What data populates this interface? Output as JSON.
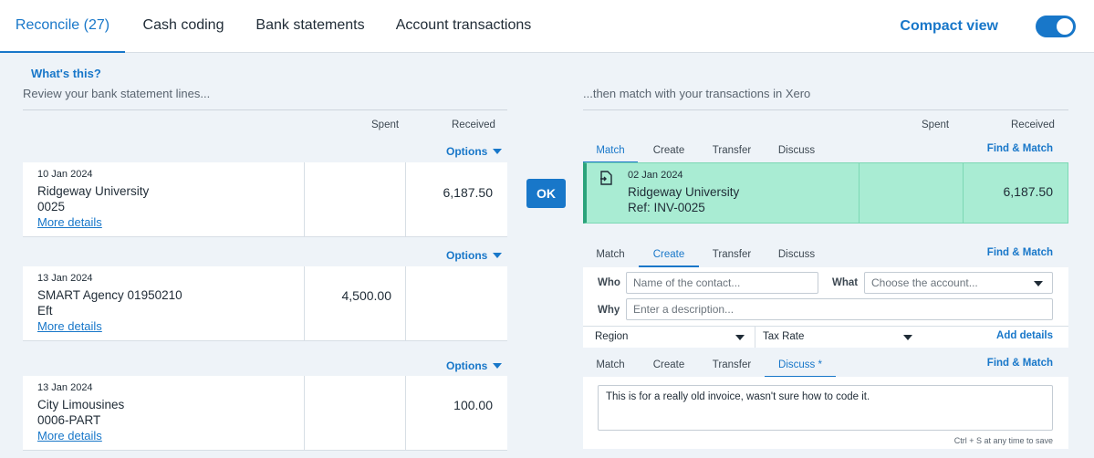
{
  "nav": {
    "tabs": [
      "Reconcile (27)",
      "Cash coding",
      "Bank statements",
      "Account transactions"
    ],
    "compact_view_label": "Compact view",
    "compact_view_on": true
  },
  "left": {
    "whats_this": "What's this?",
    "heading": "Review your bank statement lines...",
    "col_spent": "Spent",
    "col_received": "Received",
    "options_label": "Options",
    "lines": [
      {
        "date": "10 Jan 2024",
        "payee": "Ridgeway University",
        "ref": "0025",
        "more": "More details",
        "spent": "",
        "received": "6,187.50"
      },
      {
        "date": "13 Jan 2024",
        "payee": "SMART Agency 01950210",
        "ref": "Eft",
        "more": "More details",
        "spent": "4,500.00",
        "received": ""
      },
      {
        "date": "13 Jan 2024",
        "payee": "City Limousines",
        "ref": "0006-PART",
        "more": "More details",
        "spent": "",
        "received": "100.00"
      }
    ]
  },
  "ok_label": "OK",
  "right": {
    "heading": "...then match with your transactions in Xero",
    "col_spent": "Spent",
    "col_received": "Received",
    "tabs": [
      "Match",
      "Create",
      "Transfer",
      "Discuss"
    ],
    "discuss_modified": "Discuss *",
    "find_match": "Find & Match",
    "match": {
      "date": "02 Jan 2024",
      "contact": "Ridgeway University",
      "ref": "Ref: INV-0025",
      "received": "6,187.50"
    },
    "create": {
      "who_label": "Who",
      "who_placeholder": "Name of the contact...",
      "what_label": "What",
      "what_placeholder": "Choose the account...",
      "why_label": "Why",
      "why_placeholder": "Enter a description...",
      "region": "Region",
      "tax_rate": "Tax Rate",
      "add_details": "Add details"
    },
    "discuss": {
      "text": "This is for a really old invoice, wasn't sure how to code it.",
      "hint": "Ctrl + S at any time to save"
    }
  },
  "colors": {
    "accent": "#1877c9",
    "match_bg": "#a9ecd3",
    "match_border": "#2ba37b"
  }
}
